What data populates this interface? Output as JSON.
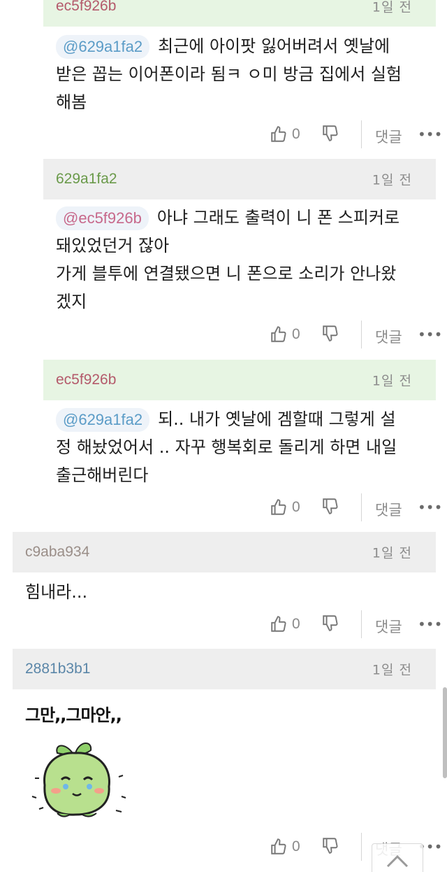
{
  "colors": {
    "green_header": "#e7f5e3",
    "gray_header": "#eeeeee",
    "user_red": "#b45a6b",
    "user_green": "#6a9a4a",
    "user_gray": "#9a8e88",
    "user_blue": "#5a86a8",
    "mention_text": "#5b9cc7",
    "mention_pink": "#c7688b"
  },
  "icons": {
    "like": "thumbs-up-icon",
    "dislike": "thumbs-down-icon",
    "more": "more-dots-icon",
    "scroll_top": "chevron-up-icon"
  },
  "comments": [
    {
      "user": "ec5f926b",
      "time": "1일 전",
      "mention": "@629a1fa2",
      "lines": [
        "최근에 아이팟 잃어버려서 옛날에",
        "받은 꼽는 이어폰이라 됨ㅋ ㅇ미 방금 집에서 실험",
        "해봄"
      ],
      "likes": "0",
      "reply": "댓글",
      "more": "•••"
    },
    {
      "user": "629a1fa2",
      "time": "1일 전",
      "mention": "@ec5f926b",
      "lines": [
        "아냐 그래도 출력이 니 폰 스피커로",
        "돼있었던거 잖아",
        "가게 블투에 연결됐으면 니 폰으로 소리가 안나왔",
        "겠지"
      ],
      "likes": "0",
      "reply": "댓글",
      "more": "•••"
    },
    {
      "user": "ec5f926b",
      "time": "1일 전",
      "mention": "@629a1fa2",
      "lines": [
        "되.. 내가 옛날에 겜할때 그렇게 설",
        "정 해놨었어서 .. 자꾸 행복회로 돌리게 하면 내일",
        "출근해버린다"
      ],
      "likes": "0",
      "reply": "댓글",
      "more": "•••"
    },
    {
      "user": "c9aba934",
      "time": "1일 전",
      "lines": [
        "힘내라..."
      ],
      "likes": "0",
      "reply": "댓글",
      "more": "•••"
    },
    {
      "user": "2881b3b1",
      "time": "1일 전",
      "sticker_text": "그만,,그마안,,",
      "likes": "0",
      "reply": "댓글",
      "more": "•••"
    }
  ]
}
